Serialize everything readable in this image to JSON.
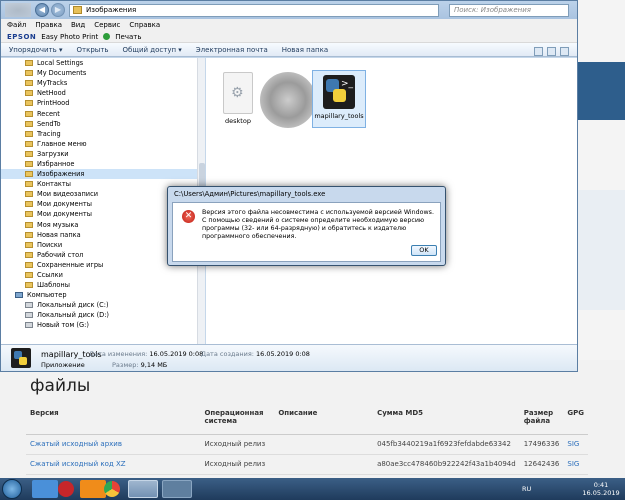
{
  "explorer": {
    "address": "Изображения",
    "search_placeholder": "Поиск: Изображения",
    "menu": [
      "Файл",
      "Правка",
      "Вид",
      "Сервис",
      "Справка"
    ],
    "epson": {
      "brand": "EPSON",
      "label": "Easy Photo Print",
      "print": "Печать"
    },
    "toolbar": [
      "Упорядочить ▾",
      "Открыть",
      "Общий доступ ▾",
      "Электронная почта",
      "Новая папка"
    ],
    "nav_items": [
      {
        "label": "Local Settings",
        "kind": "folder"
      },
      {
        "label": "My Documents",
        "kind": "folder"
      },
      {
        "label": "MyTracks",
        "kind": "folder"
      },
      {
        "label": "NetHood",
        "kind": "folder"
      },
      {
        "label": "PrintHood",
        "kind": "folder"
      },
      {
        "label": "Recent",
        "kind": "folder"
      },
      {
        "label": "SendTo",
        "kind": "folder"
      },
      {
        "label": "Tracing",
        "kind": "folder"
      },
      {
        "label": "Главное меню",
        "kind": "folder"
      },
      {
        "label": "Загрузки",
        "kind": "folder"
      },
      {
        "label": "Избранное",
        "kind": "folder"
      },
      {
        "label": "Изображения",
        "kind": "folder",
        "selected": true
      },
      {
        "label": "Контакты",
        "kind": "folder"
      },
      {
        "label": "Мои видеозаписи",
        "kind": "folder"
      },
      {
        "label": "Мои документы",
        "kind": "folder"
      },
      {
        "label": "Мои документы",
        "kind": "folder"
      },
      {
        "label": "Моя музыка",
        "kind": "folder"
      },
      {
        "label": "Новая папка",
        "kind": "folder"
      },
      {
        "label": "Поиски",
        "kind": "folder"
      },
      {
        "label": "Рабочий стол",
        "kind": "folder"
      },
      {
        "label": "Сохраненные игры",
        "kind": "folder"
      },
      {
        "label": "Ссылки",
        "kind": "folder"
      },
      {
        "label": "Шаблоны",
        "kind": "folder"
      },
      {
        "label": "Компьютер",
        "kind": "computer"
      },
      {
        "label": "Локальный диск (C:)",
        "kind": "drive"
      },
      {
        "label": "Локальный диск (D:)",
        "kind": "drive"
      },
      {
        "label": "Новый том (G:)",
        "kind": "drive"
      }
    ],
    "files": {
      "desktop": "desktop",
      "mapillary": "mapillary_tools"
    },
    "details": {
      "name": "mapillary_tools",
      "type": "Приложение",
      "modified_k": "Дата изменения:",
      "modified_v": "16.05.2019 0:08",
      "created_k": "Дата создания:",
      "created_v": "16.05.2019 0:08",
      "size_k": "Размер:",
      "size_v": "9,14 МБ"
    }
  },
  "dialog": {
    "title": "C:\\Users\\Админ\\Pictures\\mapillary_tools.exe",
    "message": "Версия этого файла несовместима с используемой версией Windows. С помощью сведений о системе определите необходимую версию программы (32- или 64-разрядную) и обратитесь к издателю программного обеспечения.",
    "ok": "OK"
  },
  "webpage": {
    "heading": "файлы",
    "columns": [
      "Версия",
      "Операционная система",
      "Описание",
      "Сумма MD5",
      "Размер файла",
      "GPG"
    ],
    "rows": [
      {
        "version": "Сжатый исходный архив",
        "os": "Исходный релиз",
        "desc": "",
        "md5": "045fb3440219a1f6923fefdabde63342",
        "size": "17496336",
        "gpg": "SIG"
      },
      {
        "version": "Сжатый исходный код XZ",
        "os": "Исходный релиз",
        "desc": "",
        "md5": "a80ae3cc478460b922242f43a1b4094d",
        "size": "12642436",
        "gpg": "SIG"
      }
    ]
  },
  "taskbar": {
    "lang": "RU",
    "time": "0:41",
    "date": "16.05.2019"
  }
}
